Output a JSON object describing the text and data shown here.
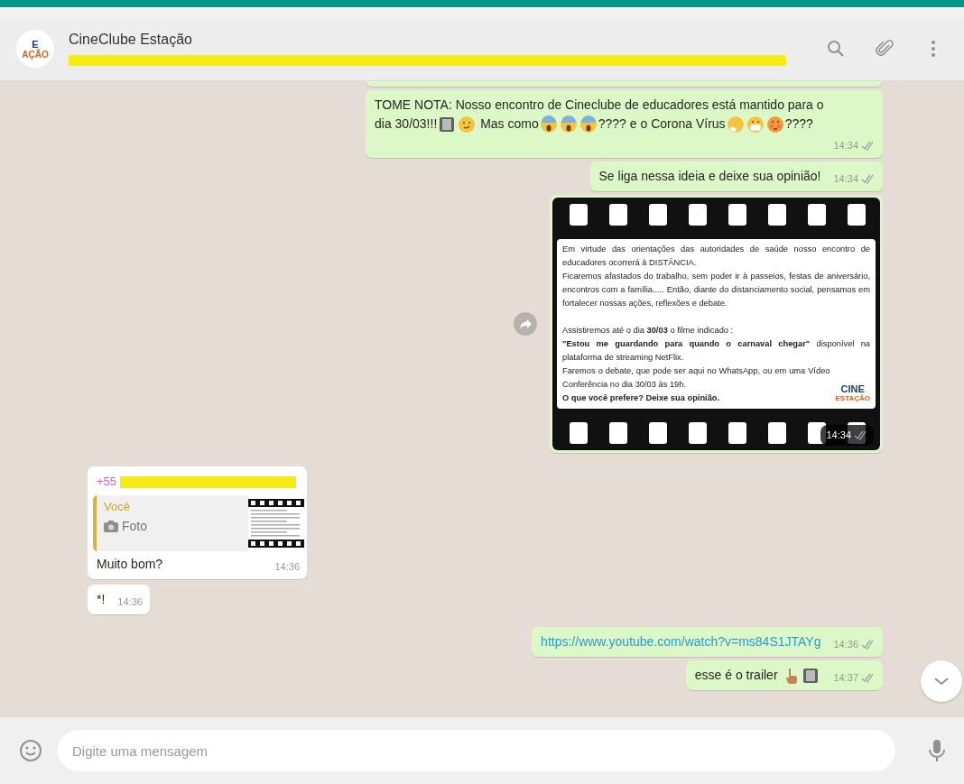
{
  "header": {
    "avatar": {
      "line_1": "E",
      "line_2": "AÇÃO"
    },
    "title": "CineClube Estação",
    "subtitle": {
      "redacted": true
    }
  },
  "messages": [
    {
      "kind": "clipped",
      "incoming": false
    },
    {
      "kind": "text",
      "incoming": false,
      "read": false,
      "time": "14:34",
      "parts": [
        {
          "kind": "text",
          "text": "TOME NOTA: Nosso encontro de Cineclube de educadores está mantido para o"
        },
        {
          "kind": "text",
          "text": "dia 30/03!!!"
        },
        {
          "kind": "film"
        },
        {
          "kind": "smirk"
        },
        {
          "kind": "text",
          "text": " Mas como"
        },
        {
          "kind": "scream"
        },
        {
          "kind": "scream"
        },
        {
          "kind": "scream"
        },
        {
          "kind": "text",
          "text": "???? e o Corona Vírus"
        },
        {
          "kind": "sneeze"
        },
        {
          "kind": "mask"
        },
        {
          "kind": "dizzy"
        },
        {
          "kind": "text",
          "text": "????"
        }
      ]
    },
    {
      "kind": "text",
      "incoming": false,
      "read": false,
      "time": "14:34",
      "parts": [
        {
          "kind": "text",
          "text": "Se liga nessa ideia e deixe sua opinião!"
        }
      ]
    },
    {
      "kind": "image",
      "incoming": false,
      "read": false,
      "time": "14:34",
      "forward": true,
      "flyer": {
        "paragraphs": [
          {
            "text": "Em virtude das orientações das autoridades de saúde nosso encontro de educadores ocorrerá à DISTÂNCIA.",
            "bold": false,
            "gap_after": false
          },
          {
            "text": "Ficaremos afastados do trabalho, sem poder ir à passeios, festas de aniversário, encontros com a família..... Então, diante do distanciamento social, pensamos em fortalecer nossas ações, reflexões e debate.",
            "bold": false,
            "gap_after": true
          },
          {
            "text": "Assistiremos até o dia **30/03**  o filme indicado :",
            "bold": false,
            "gap_after": false
          },
          {
            "text": "**\"Estou me guardando para quando o carnaval chegar\"** disponível na plataforma de  streaming NetFlix.",
            "bold": false,
            "gap_after": false
          },
          {
            "text": "Faremos o debate, que pode  ser aqui no WhatsApp, ou em uma Vídeo Conferência no dia 30/03 às 19h.",
            "bold": false,
            "gap_after": false
          },
          {
            "text": "O que você prefere? Deixe sua opinião.",
            "bold": true,
            "gap_after": false
          }
        ],
        "logo": {
          "line_1": "CINE",
          "line_2": "ESTAÇÃO"
        }
      }
    },
    {
      "kind": "reply",
      "incoming": true,
      "sender": "+55",
      "sender_redacted": true,
      "quote": {
        "author": "Você",
        "label": "Foto"
      },
      "time": "14:36",
      "parts": [
        {
          "kind": "text",
          "text": "Muito bom?"
        }
      ]
    },
    {
      "kind": "text",
      "incoming": true,
      "time": "14:36",
      "parts": [
        {
          "kind": "text",
          "text": "*!"
        }
      ]
    },
    {
      "kind": "text",
      "incoming": false,
      "read": false,
      "time": "14:36",
      "parts": [
        {
          "kind": "link",
          "text": "https://www.youtube.com/watch?v=ms84S1JTAYg"
        }
      ]
    },
    {
      "kind": "text",
      "incoming": false,
      "read": false,
      "time": "14:37",
      "parts": [
        {
          "kind": "text",
          "text": "esse é o trailer "
        },
        {
          "kind": "pointing"
        },
        {
          "kind": "film"
        }
      ]
    }
  ],
  "composer": {
    "placeholder": "Digite uma mensagem"
  }
}
